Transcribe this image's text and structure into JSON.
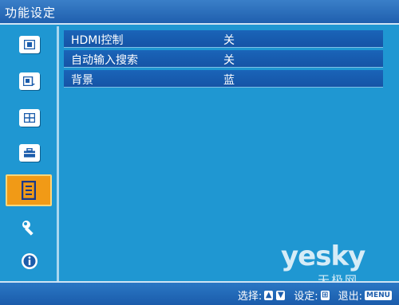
{
  "window": {
    "title": "功能设定"
  },
  "sidebar": {
    "items": [
      {
        "icon": "picture-icon"
      },
      {
        "icon": "picture-input-icon"
      },
      {
        "icon": "screen-layout-icon"
      },
      {
        "icon": "toolbox-icon"
      },
      {
        "icon": "function-settings-icon",
        "active": true
      },
      {
        "icon": "wrench-icon"
      },
      {
        "icon": "info-icon"
      }
    ]
  },
  "settings": [
    {
      "label": "HDMI控制",
      "value": "关"
    },
    {
      "label": "自动输入搜索",
      "value": "关"
    },
    {
      "label": "背景",
      "value": "蓝"
    }
  ],
  "footer": {
    "select_label": "选择:",
    "confirm_label": "设定:",
    "exit_label": "退出:",
    "menu_key": "MENU"
  },
  "watermark": {
    "en": "yesky",
    "cn": "天极网"
  },
  "colors": {
    "background": "#1f97d2",
    "row": "#1554a6",
    "active": "#f19a16"
  }
}
